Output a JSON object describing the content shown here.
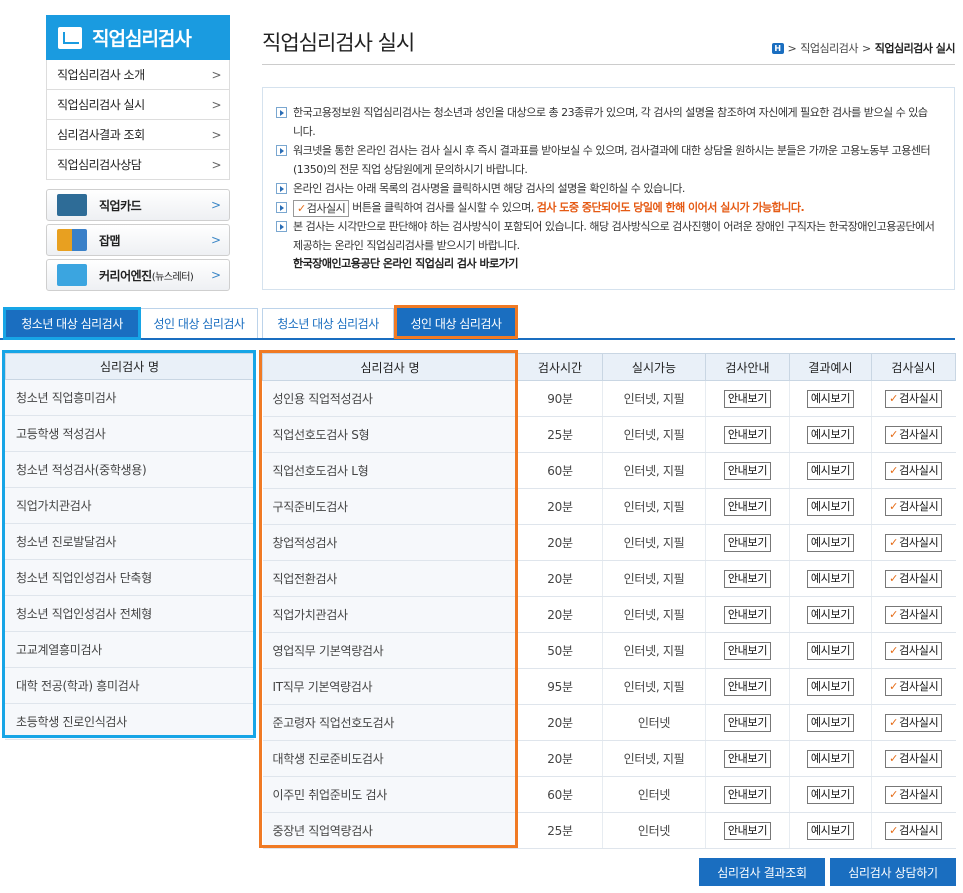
{
  "sidebar": {
    "title": "직업심리검사",
    "menu": [
      {
        "label": "직업심리검사 소개"
      },
      {
        "label": "직업심리검사 실시"
      },
      {
        "label": "심리검사결과 조회"
      },
      {
        "label": "직업심리검사상담"
      }
    ],
    "cards": [
      {
        "label": "직업카드",
        "sub": "",
        "icon": "job-card-icon",
        "color": "#2e6c97"
      },
      {
        "label": "잡맵",
        "sub": "",
        "icon": "job-map-icon",
        "color": "#e8a020"
      },
      {
        "label": "커리어엔진",
        "sub": "(뉴스레터)",
        "icon": "career-engine-icon",
        "color": "#3ba5e0"
      }
    ]
  },
  "header": {
    "title": "직업심리검사 실시",
    "breadcrumb": [
      "H",
      "직업심리검사",
      "직업심리검사 실시"
    ]
  },
  "info": {
    "lines": [
      "한국고용정보원 직업심리검사는 청소년과 성인을 대상으로 총 23종류가 있으며, 각 검사의 설명을 참조하여 자신에게 필요한 검사를 받으실 수 있습니다.",
      "워크넷을 통한 온라인 검사는 검사 실시 후 즉시 결과표를 받아보실 수 있으며, 검사결과에 대한 상담을 원하시는 분들은 가까운 고용노동부 고용센터(1350)의 전문 직업 상담원에게 문의하시기 바랍니다.",
      "온라인 검사는 아래 목록의 검사명을 클릭하시면 해당 검사의 설명을 확인하실 수 있습니다."
    ],
    "line4_btn": "검사실시",
    "line4_text": "버튼을 클릭하여 검사를 실시할 수 있으며,",
    "line4_red": "검사 도중 중단되어도 당일에 한해 이어서 실시가 가능합니다.",
    "line5": "본 검사는 시각만으로 판단해야 하는 검사방식이 포함되어 있습니다. 해당 검사방식으로 검사진행이 어려운 장애인 구직자는 한국장애인고용공단에서 제공하는 온라인 직업심리검사를 받으시기 바랍니다.",
    "link": "한국장애인고용공단 온라인 직업심리 검사 바로가기"
  },
  "tabs": [
    {
      "label": "청소년 대상 심리검사",
      "active": true
    },
    {
      "label": "성인 대상 심리검사",
      "active": false
    },
    {
      "label": "청소년 대상 심리검사",
      "active": false
    },
    {
      "label": "성인 대상 심리검사",
      "active": true
    }
  ],
  "youth_table": {
    "header": "심리검사 명",
    "rows": [
      "청소년 직업흥미검사",
      "고등학생 적성검사",
      "청소년 적성검사(중학생용)",
      "직업가치관검사",
      "청소년 진로발달검사",
      "청소년 직업인성검사 단축형",
      "청소년 직업인성검사 전체형",
      "고교계열흥미검사",
      "대학 전공(학과) 흥미검사",
      "초등학생 진로인식검사"
    ]
  },
  "adult_table": {
    "headers": [
      "심리검사 명",
      "검사시간",
      "실시가능",
      "검사안내",
      "결과예시",
      "검사실시"
    ],
    "guide_btn": "안내보기",
    "example_btn": "예시보기",
    "run_btn": "검사실시",
    "rows": [
      {
        "name": "성인용 직업적성검사",
        "time": "90분",
        "mode": "인터넷, 지필"
      },
      {
        "name": "직업선호도검사 S형",
        "time": "25분",
        "mode": "인터넷, 지필"
      },
      {
        "name": "직업선호도검사 L형",
        "time": "60분",
        "mode": "인터넷, 지필"
      },
      {
        "name": "구직준비도검사",
        "time": "20분",
        "mode": "인터넷, 지필"
      },
      {
        "name": "창업적성검사",
        "time": "20분",
        "mode": "인터넷, 지필"
      },
      {
        "name": "직업전환검사",
        "time": "20분",
        "mode": "인터넷, 지필"
      },
      {
        "name": "직업가치관검사",
        "time": "20분",
        "mode": "인터넷, 지필"
      },
      {
        "name": "영업직무 기본역량검사",
        "time": "50분",
        "mode": "인터넷, 지필"
      },
      {
        "name": "IT직무 기본역량검사",
        "time": "95분",
        "mode": "인터넷, 지필"
      },
      {
        "name": "준고령자 직업선호도검사",
        "time": "20분",
        "mode": "인터넷"
      },
      {
        "name": "대학생 진로준비도검사",
        "time": "20분",
        "mode": "인터넷, 지필"
      },
      {
        "name": "이주민 취업준비도 검사",
        "time": "60분",
        "mode": "인터넷"
      },
      {
        "name": "중장년 직업역량검사",
        "time": "25분",
        "mode": "인터넷"
      }
    ]
  },
  "bottom": {
    "result_btn": "심리검사 결과조회",
    "consult_btn": "심리검사 상담하기"
  },
  "colors": {
    "primary": "#1a6ec0",
    "sidebar": "#1a9be0",
    "highlight_orange": "#f07a24",
    "highlight_blue": "#17a5e6"
  }
}
